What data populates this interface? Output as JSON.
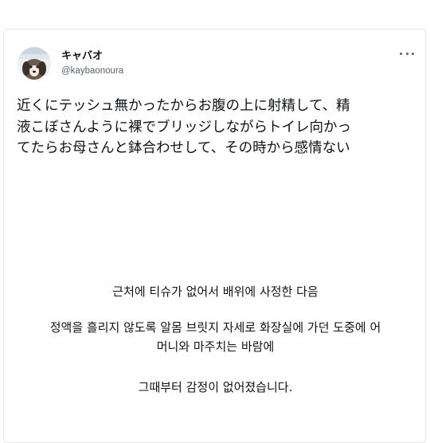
{
  "tweet": {
    "author": {
      "display_name": "キャバオ",
      "handle": "@kaybaonoura"
    },
    "more_icon": "more-horizontal-icon",
    "text_lines": [
      "近くにテッシュ無かったからお腹の上に射精して、精",
      "液こぼさんように裸でブリッジしながらトイレ向かっ",
      "てたらお母さんと鉢合わせして、その時から感情ない"
    ]
  },
  "translation": {
    "line1": "근처에 티슈가 없어서 배위에 사정한 다음",
    "line2a": "정액을 흘리지 않도록 알몸 브릿지 자세로 화장실에 가던 도중에 어",
    "line2b": "머니와 마주치는 바람에",
    "line3": "그때부터 감정이 없어졌습니다."
  }
}
